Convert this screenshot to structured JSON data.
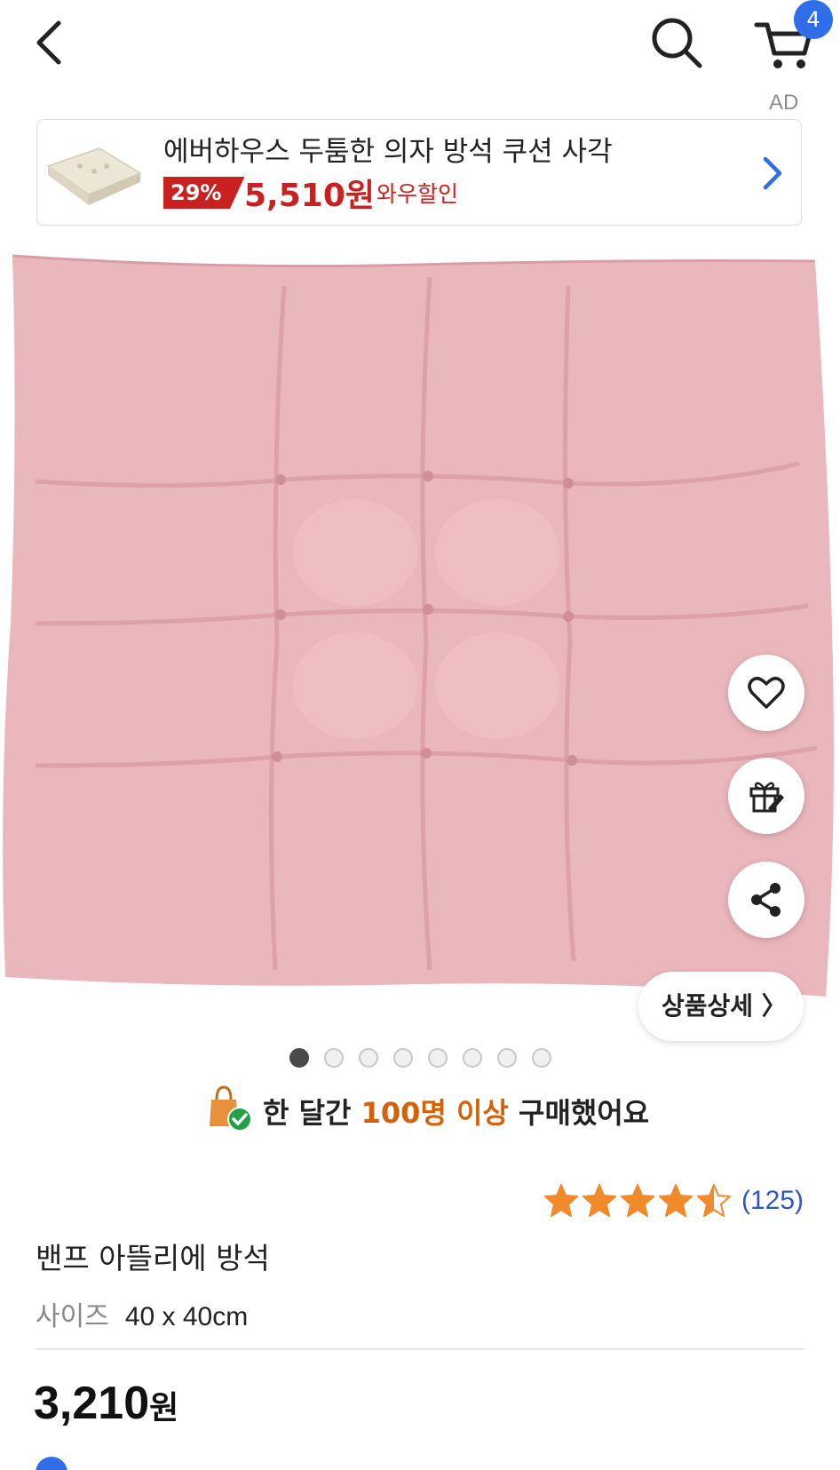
{
  "header": {
    "cart_count": "4",
    "ad_label": "AD"
  },
  "ad": {
    "title": "에버하우스 두툼한 의자 방석 쿠션 사각",
    "discount": "29%",
    "price": "5,510원",
    "wow_label": "와우할인"
  },
  "product_image": {
    "color": "#eab7bc"
  },
  "actions": {
    "detail_label": "상품상세 〉"
  },
  "carousel": {
    "total_slides": 8,
    "active_index": 0
  },
  "social_proof": {
    "prefix": "한 달간 ",
    "highlight": "100명 이상",
    "suffix": " 구매했어요"
  },
  "rating": {
    "score": 4.5,
    "max": 5,
    "count": "(125)",
    "color": "#f08a2a"
  },
  "product": {
    "title": "밴프 아뜰리에 방석",
    "option_label": "사이즈",
    "option_value": "40 x 40cm",
    "price_number": "3,210",
    "price_unit": "원"
  }
}
